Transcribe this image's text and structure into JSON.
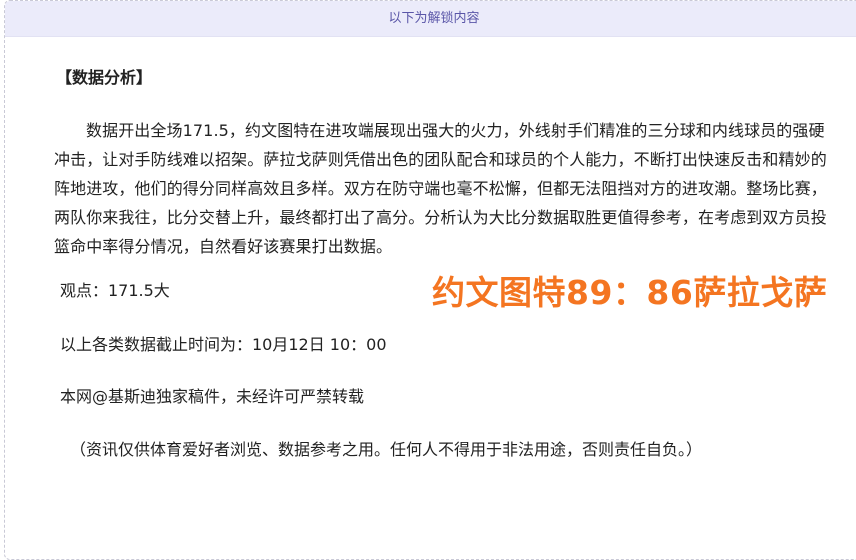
{
  "unlock_banner": "以下为解锁内容",
  "section_title": "【数据分析】",
  "analysis_paragraph": "数据开出全场171.5，约文图特在进攻端展现出强大的火力，外线射手们精准的三分球和内线球员的强硬冲击，让对手防线难以招架。萨拉戈萨则凭借出色的团队配合和球员的个人能力，不断打出快速反击和精妙的阵地进攻，他们的得分同样高效且多样。双方在防守端也毫不松懈，但都无法阻挡对方的进攻潮。整场比赛，两队你来我往，比分交替上升，最终都打出了高分。分析认为大比分数据取胜更值得参考，在考虑到双方员投篮命中率得分情况，自然看好该赛果打出数据。",
  "opinion": "观点：171.5大",
  "score_overlay": "约文图特89：86萨拉戈萨",
  "deadline": "以上各类数据截止时间为：10月12日 10：00",
  "copyright": "本网@基斯迪独家稿件，未经许可严禁转载",
  "disclaimer": "（资讯仅供体育爱好者浏览、数据参考之用。任何人不得用于非法用途，否则责任自负。）",
  "colors": {
    "accent_orange": "#f47521",
    "banner_bg": "#ebebfa",
    "banner_text": "#5a56a8"
  }
}
